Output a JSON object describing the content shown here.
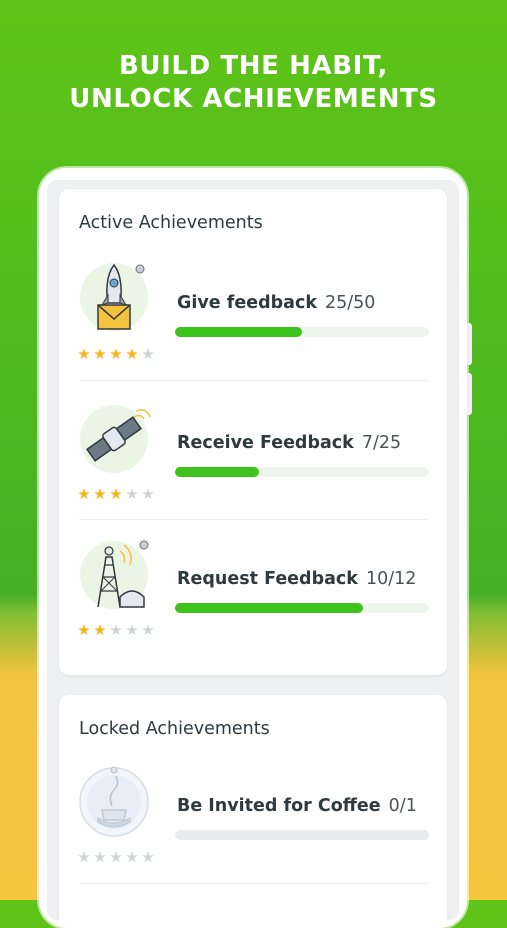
{
  "headline": {
    "line1": "BUILD THE HABIT,",
    "line2": "UNLOCK ACHIEVEMENTS"
  },
  "active": {
    "title": "Active Achievements",
    "items": [
      {
        "label": "Give feedback",
        "count": "25/50",
        "progress": 0.5,
        "stars": 4,
        "icon": "rocket-envelope-icon"
      },
      {
        "label": "Receive Feedback",
        "count": "7/25",
        "progress": 0.33,
        "stars": 3,
        "icon": "satellite-icon"
      },
      {
        "label": "Request Feedback",
        "count": "10/12",
        "progress": 0.74,
        "stars": 2,
        "icon": "radio-tower-icon"
      }
    ]
  },
  "locked": {
    "title": "Locked Achievements",
    "items": [
      {
        "label": "Be Invited for Coffee",
        "count": "0/1",
        "progress": 0,
        "stars": 0,
        "icon": "coffee-cup-icon"
      }
    ]
  },
  "colors": {
    "accent": "#3dc41c",
    "star": "#f3b51b",
    "star_off": "#cfd3d8",
    "bg_green": "#4cb91f",
    "bg_yellow": "#f5c53c"
  }
}
